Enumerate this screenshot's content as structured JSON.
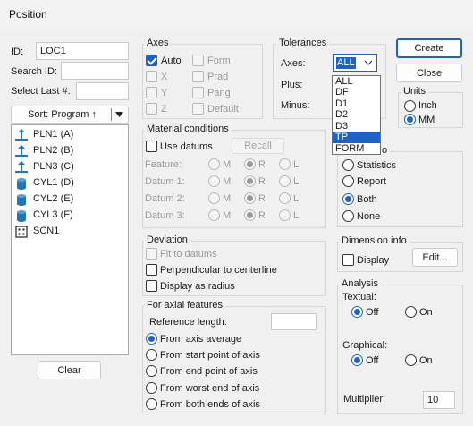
{
  "window": {
    "title": "Position"
  },
  "left": {
    "id_label": "ID:",
    "id_value": "LOC1",
    "search_label": "Search ID:",
    "search_value": "",
    "select_last_label": "Select Last #:",
    "select_last_value": "",
    "sort_label": "Sort: Program ↑",
    "features": [
      {
        "name": "PLN1 (A)",
        "icon": "plane-icon"
      },
      {
        "name": "PLN2 (B)",
        "icon": "plane-icon"
      },
      {
        "name": "PLN3 (C)",
        "icon": "plane-icon"
      },
      {
        "name": "CYL1 (D)",
        "icon": "cylinder-icon"
      },
      {
        "name": "CYL2 (E)",
        "icon": "cylinder-icon"
      },
      {
        "name": "CYL3 (F)",
        "icon": "cylinder-icon"
      },
      {
        "name": "SCN1",
        "icon": "scan-icon"
      }
    ],
    "clear_label": "Clear"
  },
  "axes": {
    "title": "Axes",
    "auto": "Auto",
    "x": "X",
    "y": "Y",
    "z": "Z",
    "form": "Form",
    "prad": "Prad",
    "pang": "Pang",
    "default": "Default"
  },
  "tolerances": {
    "title": "Tolerances",
    "axes_label": "Axes:",
    "axes_value": "ALL",
    "plus_label": "Plus:",
    "minus_label": "Minus:",
    "options": [
      "ALL",
      "DF",
      "D1",
      "D2",
      "D3",
      "TP",
      "FORM"
    ],
    "selected_option": "TP"
  },
  "buttons": {
    "create": "Create",
    "close": "Close"
  },
  "units": {
    "title": "Units",
    "inch": "Inch",
    "mm": "MM"
  },
  "output": {
    "title_suffix": "o",
    "statistics": "Statistics",
    "report": "Report",
    "both": "Both",
    "none": "None"
  },
  "material": {
    "title": "Material conditions",
    "use_datums": "Use datums",
    "recall": "Recall",
    "rows": [
      "Feature:",
      "Datum 1:",
      "Datum 2:",
      "Datum 3:"
    ],
    "m": "M",
    "r": "R",
    "l": "L"
  },
  "deviation": {
    "title": "Deviation",
    "fit": "Fit to datums",
    "perp": "Perpendicular to centerline",
    "radius": "Display as radius"
  },
  "axial": {
    "title": "For axial features",
    "ref_label": "Reference length:",
    "ref_value": "",
    "opts": [
      "From axis average",
      "From start point of axis",
      "From end point of axis",
      "From worst end of axis",
      "From both ends of axis"
    ]
  },
  "dimension_info": {
    "title": "Dimension info",
    "display": "Display",
    "edit": "Edit..."
  },
  "analysis": {
    "title": "Analysis",
    "textual": "Textual:",
    "graphical": "Graphical:",
    "off": "Off",
    "on": "On",
    "multiplier_label": "Multiplier:",
    "multiplier_value": "10"
  },
  "colors": {
    "accent": "#1e63c4"
  }
}
